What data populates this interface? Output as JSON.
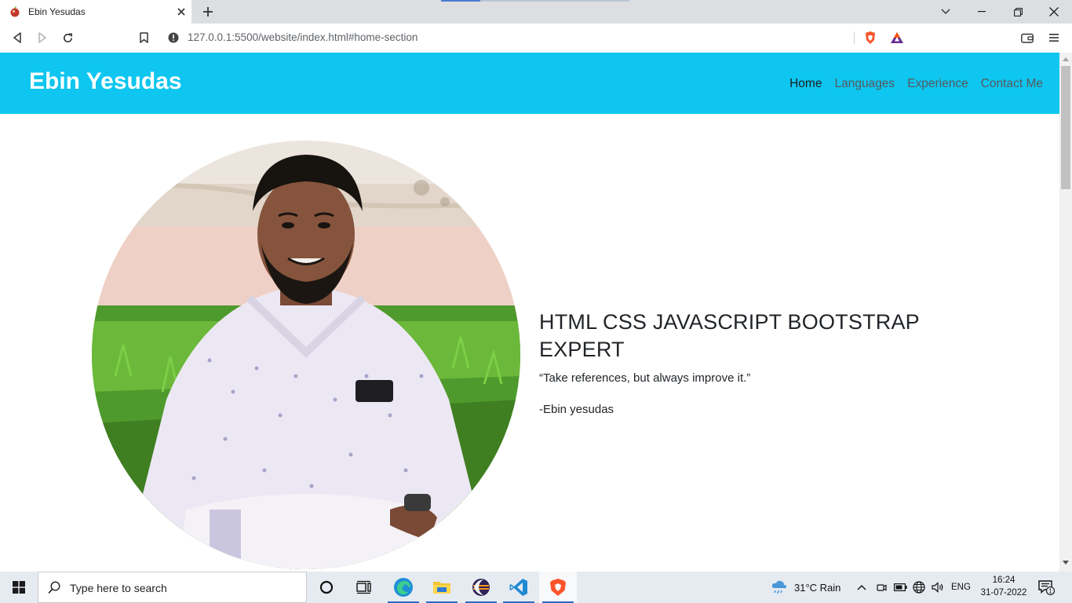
{
  "browser": {
    "tab_title": "Ebin Yesudas",
    "url": "127.0.0.1:5500/website/index.html#home-section"
  },
  "site": {
    "brand": "Ebin Yesudas",
    "nav": [
      {
        "label": "Home",
        "active": true
      },
      {
        "label": "Languages",
        "active": false
      },
      {
        "label": "Experience",
        "active": false
      },
      {
        "label": "Contact Me",
        "active": false
      }
    ],
    "headline": "HTML CSS JAVASCRIPT BOOTSTRAP EXPERT",
    "quote": "“Take references, but always improve it.”",
    "author": "-Ebin yesudas",
    "accent_color": "#0ec6ef"
  },
  "taskbar": {
    "search_placeholder": "Type here to search",
    "weather": "31°C  Rain",
    "language": "ENG",
    "time": "16:24",
    "date": "31-07-2022",
    "notification_count": "1",
    "pinned_apps": [
      "task-view-icon",
      "edge-icon",
      "file-explorer-icon",
      "eclipse-icon",
      "vscode-icon",
      "brave-icon"
    ]
  }
}
